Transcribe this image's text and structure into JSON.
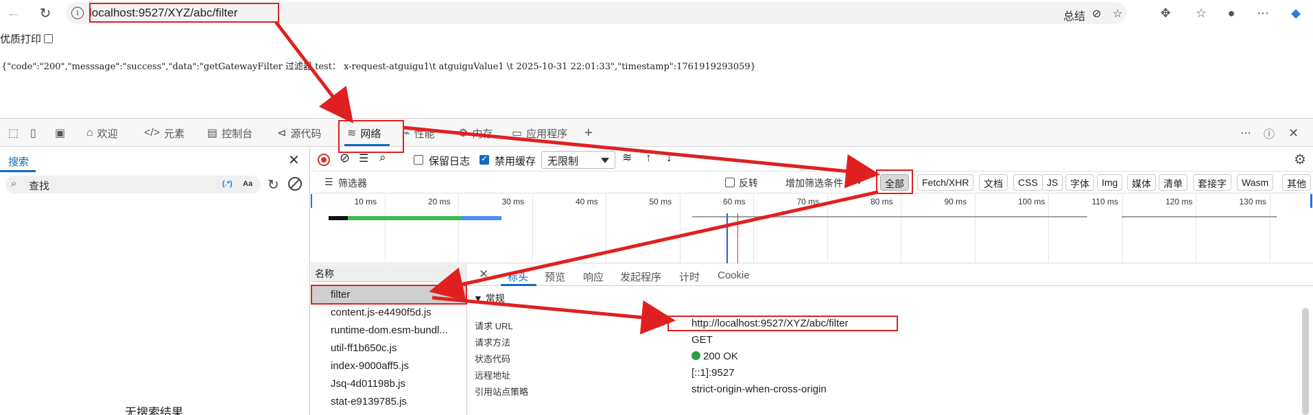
{
  "browser": {
    "url": "localhost:9527/XYZ/abc/filter",
    "right_label": "总结"
  },
  "page": {
    "print_label": "优质打印",
    "json_text": "{\"code\":\"200\",\"messsage\":\"success\",\"data\":\"getGatewayFilter 过滤器 test： x-request-atguigu1\\t atguiguValue1  \\t 2025-10-31 22:01:33\",\"timestamp\":1761919293059}"
  },
  "devtools": {
    "tabs": [
      "欢迎",
      "元素",
      "控制台",
      "源代码",
      "网络",
      "性能",
      "内存",
      "应用程序"
    ],
    "left_panel": {
      "tab": "搜索",
      "search_value": "查找",
      "regex_label": "(.*)",
      "case_label": "Aa",
      "no_results": "无搜索结果"
    },
    "toolbar": {
      "preserve_log": "保留日志",
      "disable_cache": "禁用缓存",
      "throttle": "无限制"
    },
    "filter_bar": {
      "filter_label": "筛选器",
      "invert_label": "反转",
      "add_filter": "增加筛选条件",
      "chips": [
        "全部",
        "Fetch/XHR",
        "文档",
        "CSS",
        "JS",
        "字体",
        "Img",
        "媒体",
        "清单",
        "套接字",
        "Wasm",
        "其他"
      ]
    },
    "timeline_ticks": [
      "10 ms",
      "20 ms",
      "30 ms",
      "40 ms",
      "50 ms",
      "60 ms",
      "70 ms",
      "80 ms",
      "90 ms",
      "100 ms",
      "110 ms",
      "120 ms",
      "130 ms"
    ],
    "requests": {
      "header": "名称",
      "items": [
        "filter",
        "content.js-e4490f5d.js",
        "runtime-dom.esm-bundl...",
        "util-ff1b650c.js",
        "index-9000aff5.js",
        "Jsq-4d01198b.js",
        "stat-e9139785.js"
      ]
    },
    "detail": {
      "tabs": [
        "标头",
        "预览",
        "响应",
        "发起程序",
        "计时",
        "Cookie"
      ],
      "section": "▼ 常规",
      "rows": [
        {
          "key": "请求 URL",
          "value": "http://localhost:9527/XYZ/abc/filter"
        },
        {
          "key": "请求方法",
          "value": "GET"
        },
        {
          "key": "状态代码",
          "value": "200 OK"
        },
        {
          "key": "远程地址",
          "value": "[::1]:9527"
        },
        {
          "key": "引用站点策略",
          "value": "strict-origin-when-cross-origin"
        }
      ]
    }
  },
  "colors": {
    "annotation_red": "#e02020",
    "accent": "#0f6cbd",
    "status_green": "#2ea043"
  }
}
